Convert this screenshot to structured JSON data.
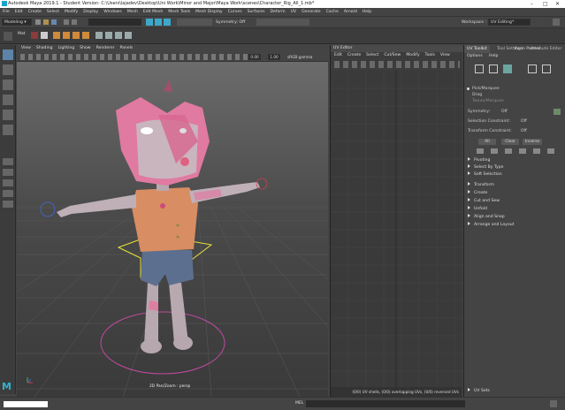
{
  "window": {
    "title": "Autodesk Maya 2019.1 - Student Version: C:\\Users\\lajadev\\Desktop\\Uni Work\\Minor and Major\\Maya Work\\scenes\\Character_Rig_All_1.mb*"
  },
  "menubar": {
    "items": [
      "File",
      "Edit",
      "Create",
      "Select",
      "Modify",
      "Display",
      "Windows",
      "Mesh",
      "Edit Mesh",
      "Mesh Tools",
      "Mesh Display",
      "Curves",
      "Surfaces",
      "Deform",
      "UV",
      "Generate",
      "Cache",
      "Arnold",
      "Help"
    ]
  },
  "statusline": {
    "menuset": "Modeling",
    "symmetry": "Symmetry: Off",
    "workspace_label": "Workspace :",
    "workspace_value": "UV Editing*"
  },
  "shelf": {
    "tab_label": "Mat"
  },
  "viewport": {
    "menu": [
      "View",
      "Shading",
      "Lighting",
      "Show",
      "Renderer",
      "Panels"
    ],
    "field_a": "0.00",
    "field_b": "1.00",
    "colorspace": "sRGB gamma",
    "camera_label": "2D Pan/Zoom : persp"
  },
  "uv_editor": {
    "title": "UV Editor",
    "menu": [
      "Edit",
      "Create",
      "Select",
      "Cut/Sew",
      "Modify",
      "Tools",
      "View"
    ],
    "footer": "(0/0) UV shells, (0/0) overlapping UVs, (0/0) reversed UVs"
  },
  "toolkit": {
    "tabs": [
      "UV Toolkit",
      "Tool Settings",
      "Attribute Editor"
    ],
    "menu": [
      "Options",
      "Help"
    ],
    "pick_marquee": "Pick/Marquee",
    "drag": "Drag",
    "tweak_marquee": "Tweak/Marquee",
    "symmetry_label": "Symmetry:",
    "symmetry_value": "Off",
    "selection_constraint_label": "Selection Constraint:",
    "selection_constraint_value": "Off",
    "transform_constraint_label": "Transform Constraint:",
    "transform_constraint_value": "Off",
    "btn_all": "All",
    "btn_clear": "Clear",
    "btn_inverse": "Inverse",
    "sections_a": [
      "Pivoting",
      "Select By Type",
      "Soft Selection"
    ],
    "sections_b": [
      "Transform",
      "Create",
      "Cut and Sew",
      "Unfold",
      "Align and Snap",
      "Arrange and Layout"
    ],
    "uv_sets": "UV Sets",
    "karin_palmer": "Karin Palmer"
  },
  "bottombar": {
    "mel": "MEL"
  },
  "colors": {
    "character_pink": "#e07aa0",
    "skin": "#c4b0b8",
    "shirt": "#d88d62",
    "shorts": "#5d6f8f",
    "accent": "#3da7c9"
  }
}
